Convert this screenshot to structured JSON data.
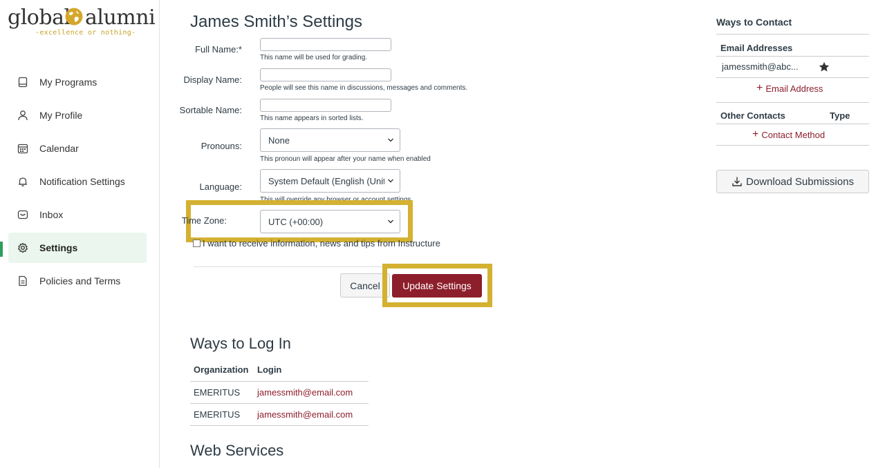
{
  "brand": {
    "word1": "global",
    "word2": "alumni",
    "tagline": "-excellence or nothing-"
  },
  "sidebar": {
    "items": [
      {
        "label": "My Programs",
        "icon": "book-icon"
      },
      {
        "label": "My Profile",
        "icon": "user-icon"
      },
      {
        "label": "Calendar",
        "icon": "calendar-icon"
      },
      {
        "label": "Notification Settings",
        "icon": "bell-icon"
      },
      {
        "label": "Inbox",
        "icon": "inbox-icon"
      },
      {
        "label": "Settings",
        "icon": "gear-icon",
        "active": true
      },
      {
        "label": "Policies and Terms",
        "icon": "document-icon"
      }
    ]
  },
  "main": {
    "title": "James Smith’s Settings",
    "form": {
      "full_name": {
        "label": "Full Name:*",
        "value": "",
        "hint": "This name will be used for grading."
      },
      "display_name": {
        "label": "Display Name:",
        "value": "",
        "hint": "People will see this name in discussions, messages and comments."
      },
      "sortable_name": {
        "label": "Sortable Name:",
        "value": "",
        "hint": "This name appears in sorted lists."
      },
      "pronouns": {
        "label": "Pronouns:",
        "value": "None",
        "hint": "This pronoun will appear after your name when enabled"
      },
      "language": {
        "label": "Language:",
        "value": "System Default (English (United States))",
        "hint": "This will override any browser or account settings."
      },
      "time_zone": {
        "label": "Time Zone:",
        "value": "UTC (+00:00)"
      },
      "newsletter": {
        "label": "I want to receive information, news and tips from Instructure",
        "checked": false
      }
    },
    "buttons": {
      "cancel": "Cancel",
      "update": "Update Settings"
    },
    "ways_to_log_in": {
      "heading": "Ways to Log In",
      "columns": [
        "Organization",
        "Login"
      ],
      "rows": [
        [
          "EMERITUS",
          "jamessmith@email.com"
        ],
        [
          "EMERITUS",
          "jamessmith@email.com"
        ]
      ]
    },
    "web_services": {
      "heading": "Web Services"
    }
  },
  "contact": {
    "title": "Ways to Contact",
    "email_header": "Email Addresses",
    "email": "jamessmith@abc...",
    "add_email": "Email Address",
    "other_header": "Other Contacts",
    "type_header": "Type",
    "add_contact": "Contact Method",
    "download": "Download Submissions"
  },
  "colors": {
    "accent": "#8d1e2b",
    "highlight": "#d4b131",
    "active_nav": "#eaf6ee",
    "active_bar": "#2e9e5b"
  }
}
